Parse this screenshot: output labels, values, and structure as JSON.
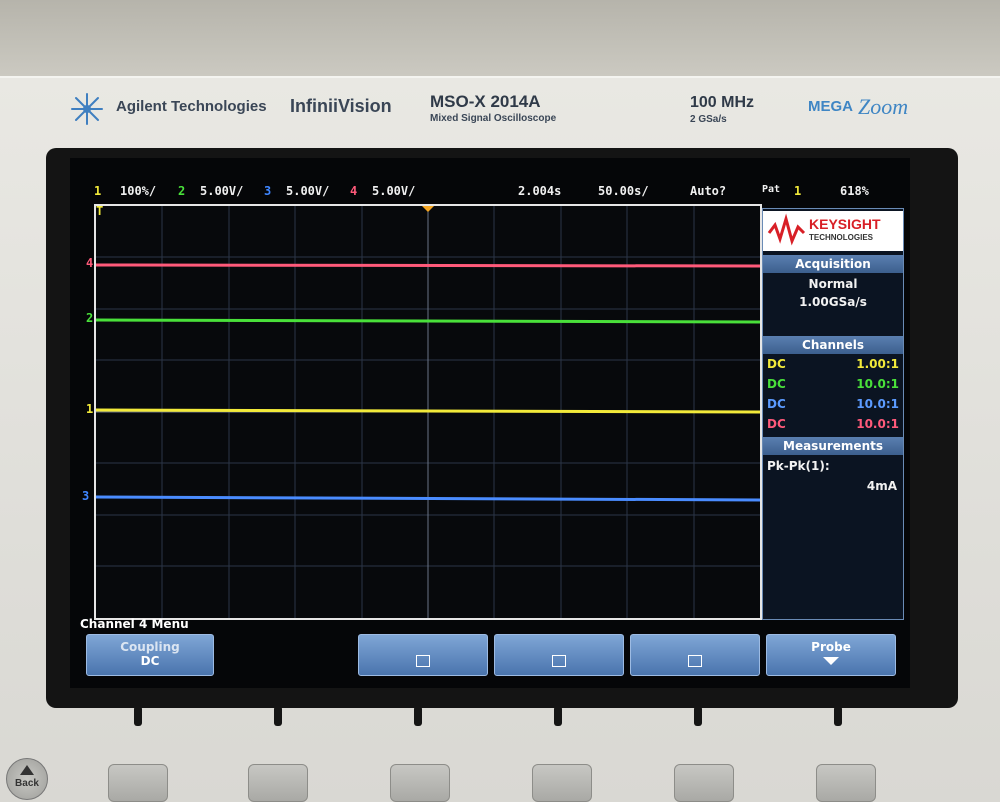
{
  "brand": {
    "company": "Agilent Technologies",
    "series": "InfiniiVision",
    "model": "MSO-X 2014A",
    "model_desc": "Mixed Signal Oscilloscope",
    "bandwidth": "100 MHz",
    "sample_rate_spec": "2 GSa/s",
    "megazoom_mega": "MEGA",
    "megazoom_zoom": "Zoom"
  },
  "status": {
    "ch1_num": "1",
    "ch1_scale": "100%/",
    "ch2_num": "2",
    "ch2_scale": "5.00V/",
    "ch3_num": "3",
    "ch3_scale": "5.00V/",
    "ch4_num": "4",
    "ch4_scale": "5.00V/",
    "time_pos": "2.004s",
    "time_scale": "50.00s/",
    "trigger_mode": "Auto?",
    "pat_label": "Pat",
    "pat_num": "1",
    "pat_value": "618%"
  },
  "markers": {
    "t": "T",
    "ch4": "4",
    "ch2": "2",
    "ch1": "1",
    "ch3": "3"
  },
  "colors": {
    "ch1": "#f2ea3a",
    "ch2": "#49e03a",
    "ch3": "#3f86ff",
    "ch4": "#ff5a7a"
  },
  "panel": {
    "logo_name": "KEYSIGHT",
    "logo_sub": "TECHNOLOGIES",
    "acquisition_title": "Acquisition",
    "acq_mode": "Normal",
    "acq_rate": "1.00GSa/s",
    "channels_title": "Channels",
    "channels": [
      {
        "coupling": "DC",
        "ratio": "1.00:1"
      },
      {
        "coupling": "DC",
        "ratio": "10.0:1"
      },
      {
        "coupling": "DC",
        "ratio": "10.0:1"
      },
      {
        "coupling": "DC",
        "ratio": "10.0:1"
      }
    ],
    "measurements_title": "Measurements",
    "meas_label": "Pk-Pk(1):",
    "meas_value": "4mA"
  },
  "menu": {
    "title": "Channel 4 Menu",
    "coupling_label": "Coupling",
    "coupling_value": "DC",
    "probe_label": "Probe"
  },
  "front": {
    "back_label": "Back"
  }
}
